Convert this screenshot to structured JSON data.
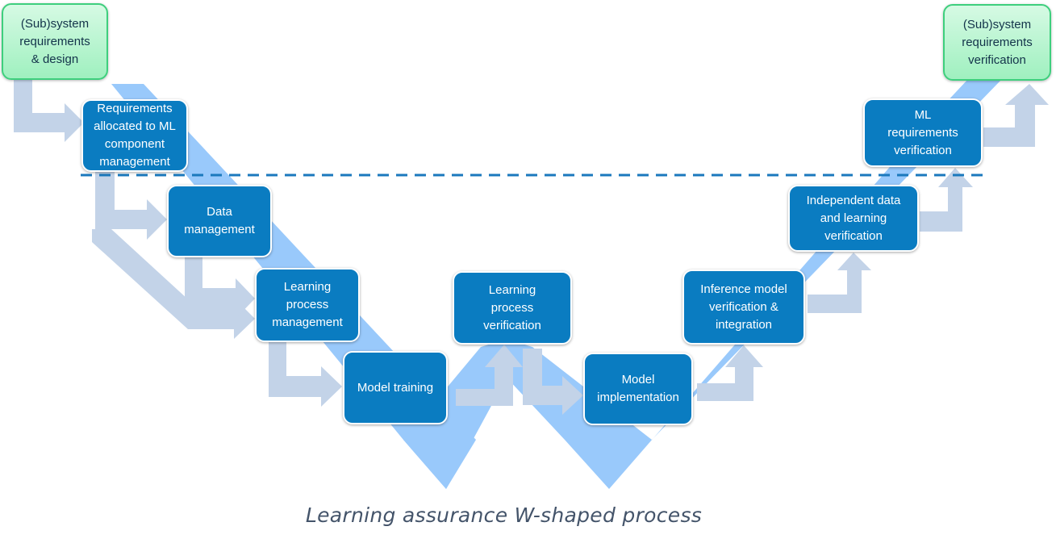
{
  "diagram": {
    "title": "Learning assurance W-shaped process",
    "colors": {
      "band": "#99c9fb",
      "arrow": "#c3d3e8",
      "step_box": "#0a7cc1",
      "system_box": "#9ff0bf",
      "system_border": "#3ecf7d",
      "dashed_line": "#1b79bd",
      "caption": "#44546a"
    },
    "nodes": [
      {
        "id": "subsystem-requirements-design",
        "kind": "system",
        "label": "(Sub)system\nrequirements\n& design"
      },
      {
        "id": "requirements-allocated-ml",
        "kind": "step",
        "label": "Requirements\nallocated to ML\ncomponent\nmanagement"
      },
      {
        "id": "data-management",
        "kind": "step",
        "label": "Data\nmanagement"
      },
      {
        "id": "learning-process-management",
        "kind": "step",
        "label": "Learning\nprocess\nmanagement"
      },
      {
        "id": "model-training",
        "kind": "step",
        "label": "Model training"
      },
      {
        "id": "learning-process-verification",
        "kind": "step",
        "label": "Learning\nprocess\nverification"
      },
      {
        "id": "model-implementation",
        "kind": "step",
        "label": "Model\nimplementation"
      },
      {
        "id": "inference-model-verification",
        "kind": "step",
        "label": "Inference model\nverification &\nintegration"
      },
      {
        "id": "independent-data-learning-verification",
        "kind": "step",
        "label": "Independent data\nand learning\nverification"
      },
      {
        "id": "ml-requirements-verification",
        "kind": "step",
        "label": "ML\nrequirements\nverification"
      },
      {
        "id": "subsystem-requirements-verification",
        "kind": "system",
        "label": "(Sub)system\nrequirements\nverification"
      }
    ],
    "edges": [
      {
        "from": "subsystem-requirements-design",
        "to": "requirements-allocated-ml"
      },
      {
        "from": "requirements-allocated-ml",
        "to": "data-management"
      },
      {
        "from": "requirements-allocated-ml",
        "to": "learning-process-management"
      },
      {
        "from": "data-management",
        "to": "learning-process-management"
      },
      {
        "from": "learning-process-management",
        "to": "model-training"
      },
      {
        "from": "model-training",
        "to": "learning-process-verification"
      },
      {
        "from": "learning-process-verification",
        "to": "model-implementation"
      },
      {
        "from": "model-implementation",
        "to": "inference-model-verification"
      },
      {
        "from": "inference-model-verification",
        "to": "independent-data-learning-verification"
      },
      {
        "from": "independent-data-learning-verification",
        "to": "ml-requirements-verification"
      },
      {
        "from": "ml-requirements-verification",
        "to": "subsystem-requirements-verification"
      }
    ],
    "separator": "dashed boundary between system level and ML component level"
  }
}
